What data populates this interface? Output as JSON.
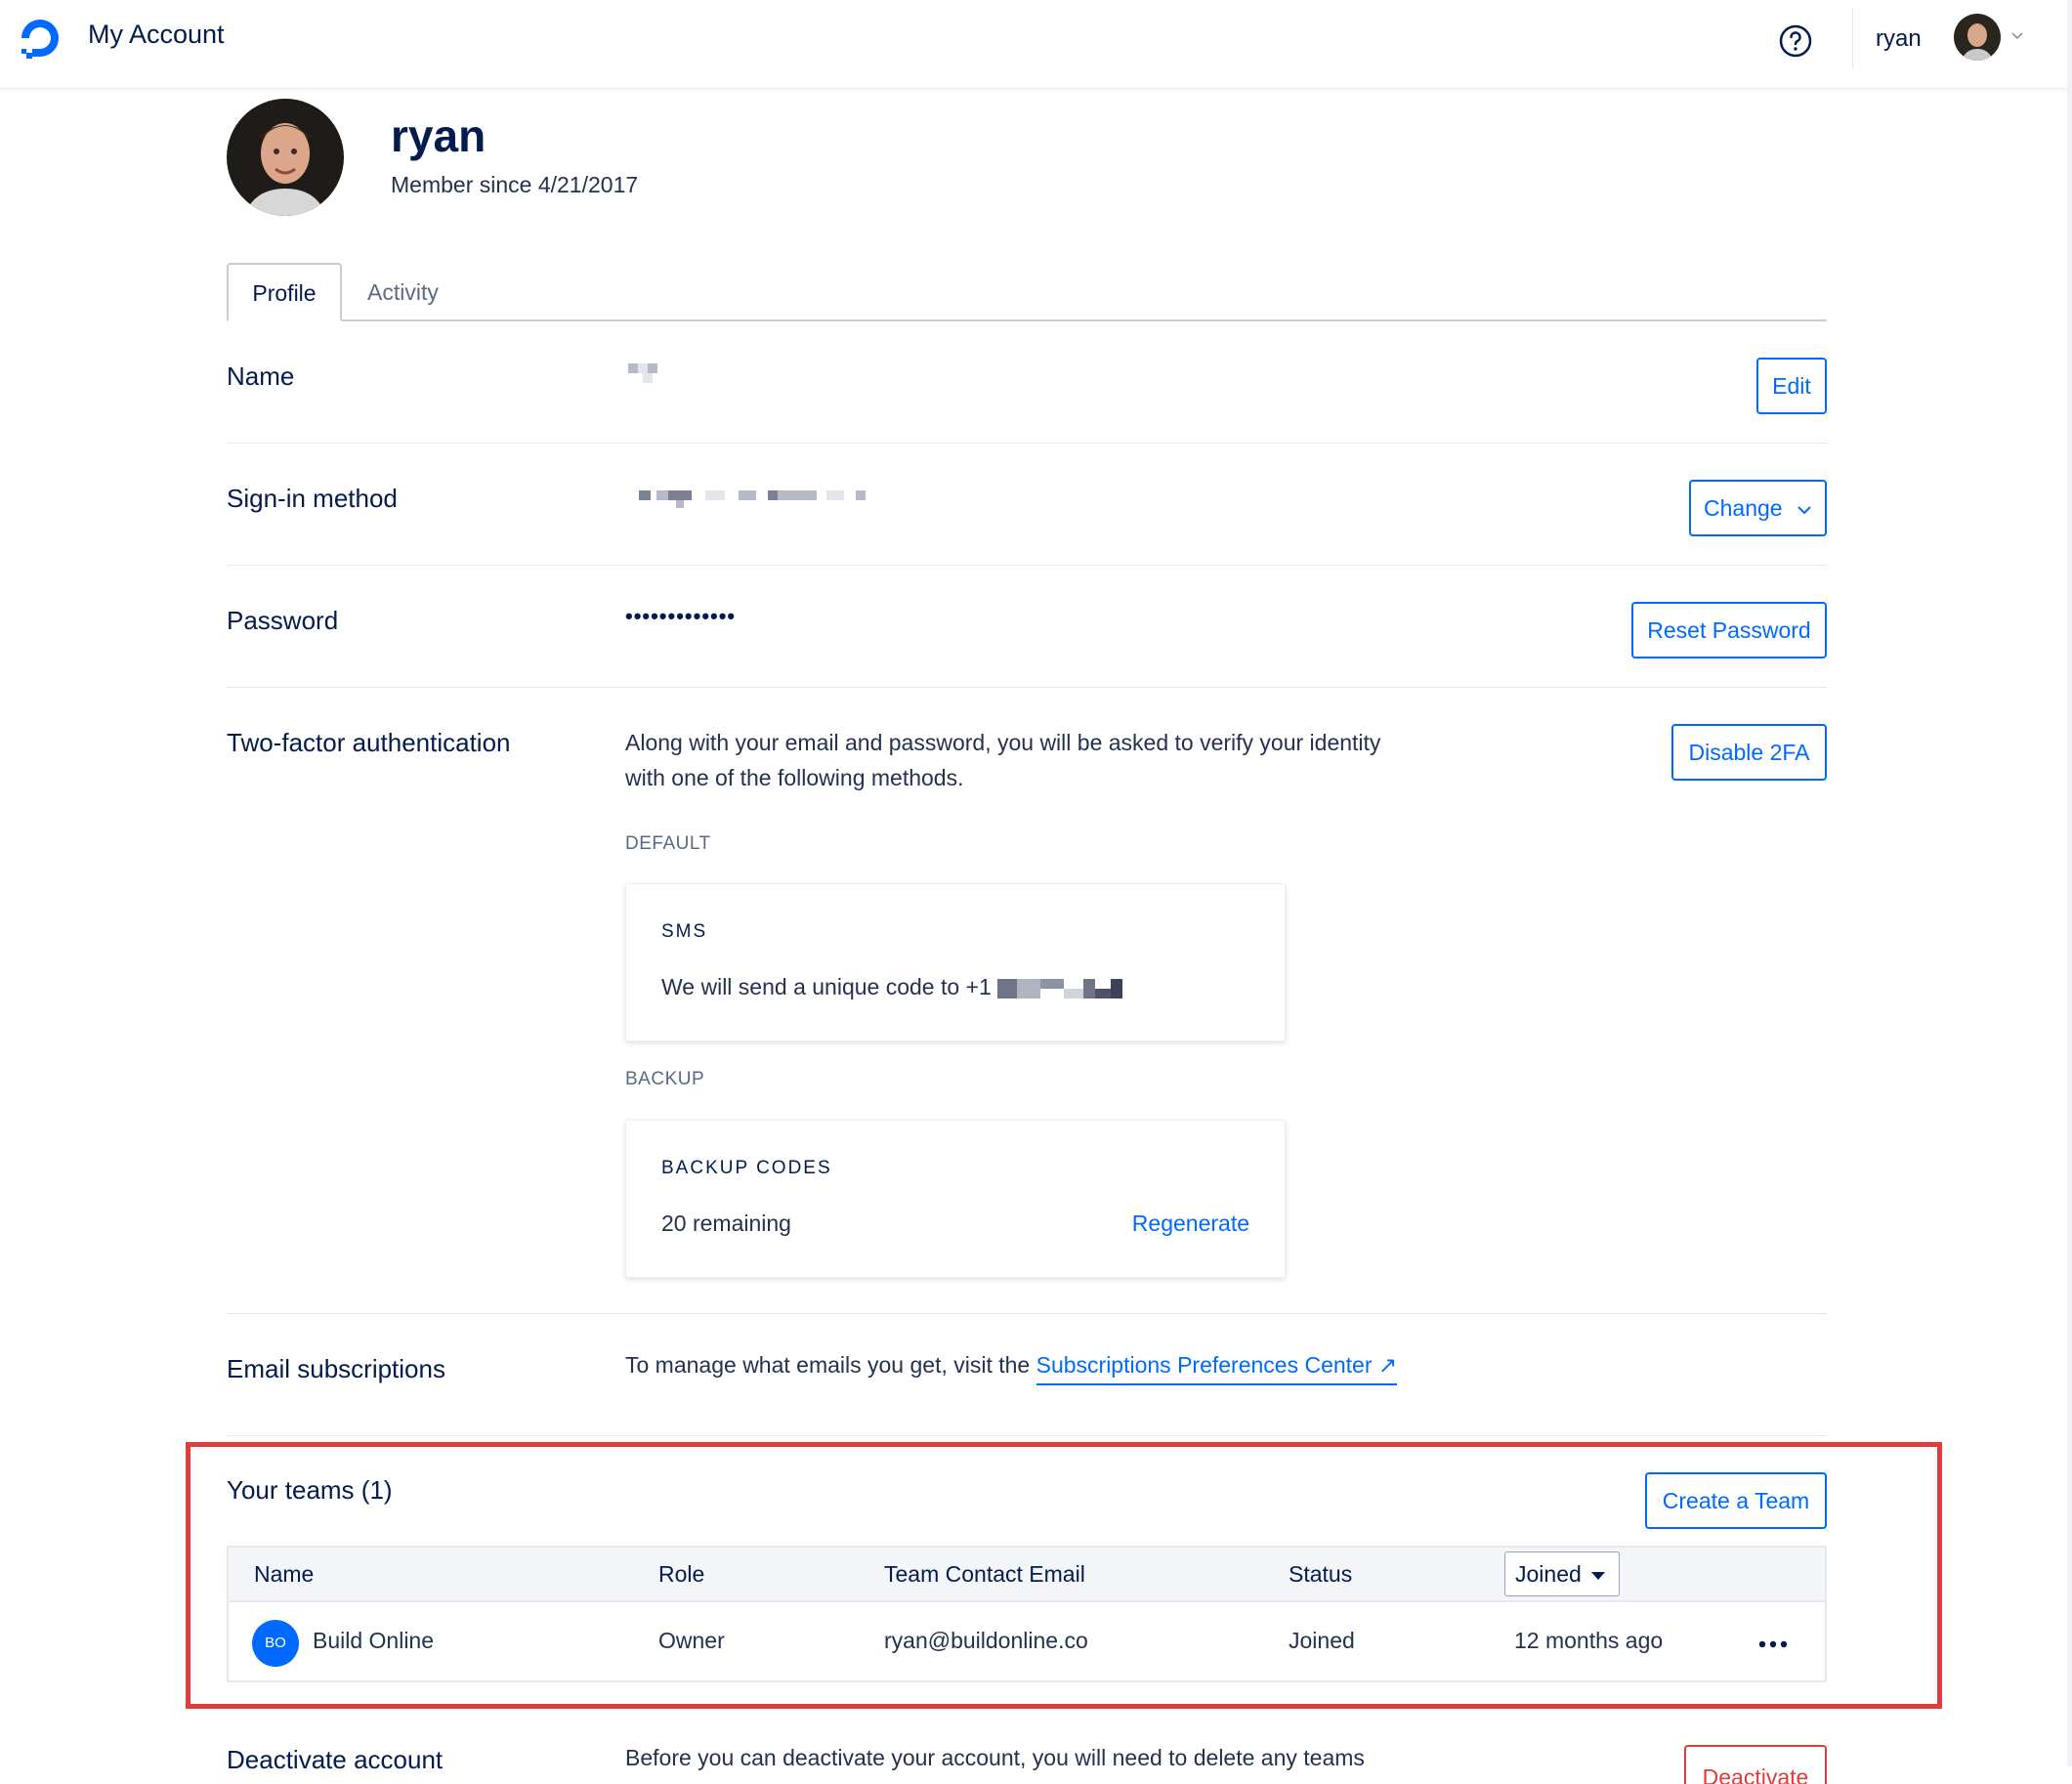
{
  "header": {
    "app_title": "My Account",
    "username": "ryan",
    "icons": [
      "digitalocean-logo-icon",
      "help-icon",
      "chevron-down-icon"
    ]
  },
  "profile": {
    "name": "ryan",
    "member_since": "Member since 4/21/2017"
  },
  "tabs": [
    {
      "label": "Profile",
      "active": true
    },
    {
      "label": "Activity",
      "active": false
    }
  ],
  "rows": {
    "name": {
      "label": "Name",
      "button": "Edit"
    },
    "signin": {
      "label": "Sign-in method",
      "button": "Change"
    },
    "password": {
      "label": "Password",
      "value": "•••••••••••••",
      "button": "Reset Password"
    },
    "twofa": {
      "label": "Two-factor authentication",
      "description": "Along with your email and password, you will be asked to verify your identity with one of the following methods.",
      "button": "Disable 2FA",
      "default_heading": "DEFAULT",
      "default_card": {
        "title": "SMS",
        "text": "We will send a unique code to +1"
      },
      "backup_heading": "BACKUP",
      "backup_card": {
        "title": "BACKUP CODES",
        "text": "20 remaining",
        "link": "Regenerate"
      }
    },
    "email": {
      "label": "Email subscriptions",
      "text": "To manage what emails you get, visit the",
      "link": "Subscriptions Preferences Center ↗"
    }
  },
  "teams": {
    "label": "Your teams (1)",
    "button": "Create a Team",
    "columns": [
      "Name",
      "Role",
      "Team Contact Email",
      "Status",
      "Joined"
    ],
    "rows": [
      {
        "initials": "BO",
        "name": "Build Online",
        "role": "Owner",
        "email": "ryan@buildonline.co",
        "status": "Joined",
        "joined": "12 months ago"
      }
    ]
  },
  "deactivate": {
    "label": "Deactivate account",
    "text": "Before you can deactivate your account, you will need to delete any teams",
    "button": "Deactivate"
  },
  "colors": {
    "accent": "#0069ff",
    "text": "#031b4e",
    "danger": "#e03c3c"
  }
}
